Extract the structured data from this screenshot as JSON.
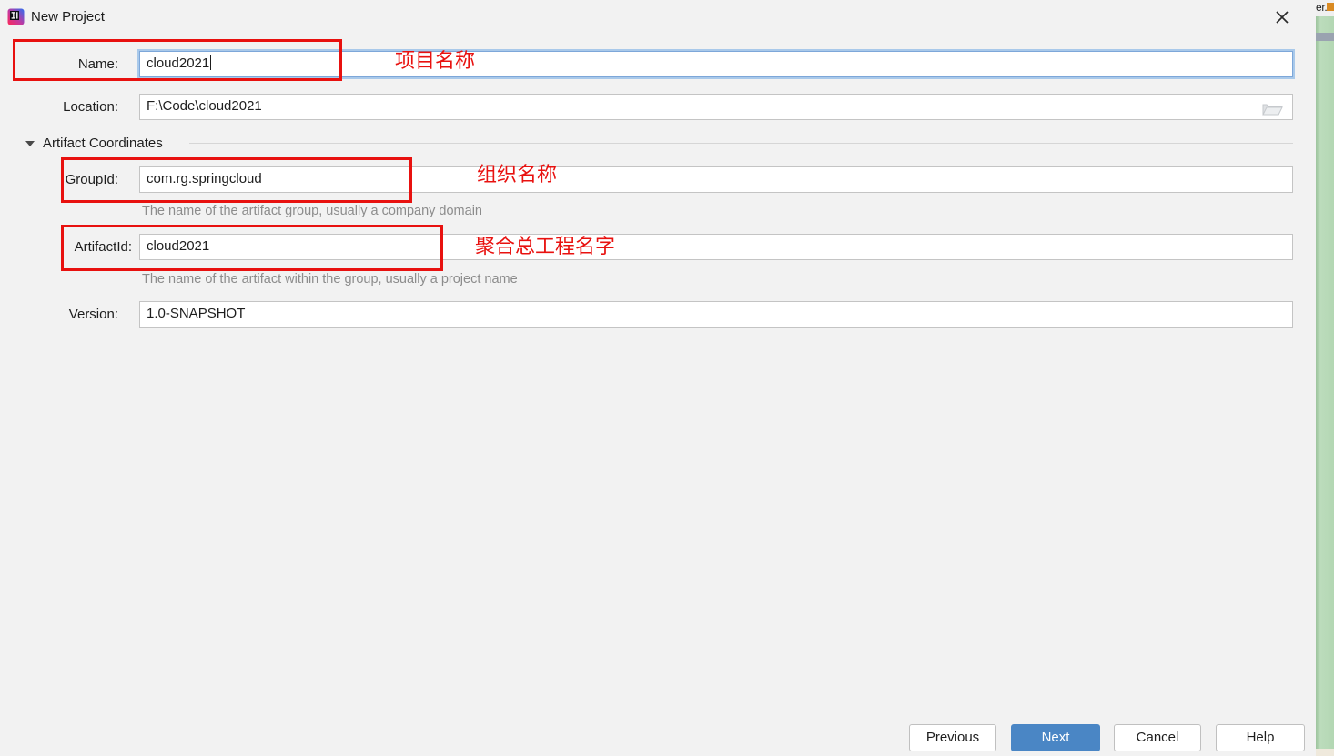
{
  "window": {
    "title": "New Project",
    "app_icon": "intellij-idea-icon",
    "close_icon": "close-icon"
  },
  "form": {
    "name": {
      "label": "Name:",
      "value": "cloud2021",
      "focused": true
    },
    "location": {
      "label": "Location:",
      "value": "F:\\Code\\cloud2021",
      "browse_icon": "folder-open-icon"
    },
    "artifact_section": {
      "title": "Artifact Coordinates",
      "expanded": true
    },
    "group_id": {
      "label": "GroupId:",
      "value": "com.rg.springcloud",
      "hint": "The name of the artifact group, usually a company domain"
    },
    "artifact_id": {
      "label": "ArtifactId:",
      "value": "cloud2021",
      "hint": "The name of the artifact within the group, usually a project name"
    },
    "version": {
      "label": "Version:",
      "value": "1.0-SNAPSHOT"
    }
  },
  "annotations": {
    "color": "#e8110f",
    "name_note": "项目名称",
    "group_id_note": "组织名称",
    "artifact_id_note": "聚合总工程名字"
  },
  "footer": {
    "previous": "Previous",
    "next": "Next",
    "cancel": "Cancel",
    "help": "Help",
    "primary_color": "#4a86c5"
  },
  "background": {
    "edge_text": "er."
  }
}
